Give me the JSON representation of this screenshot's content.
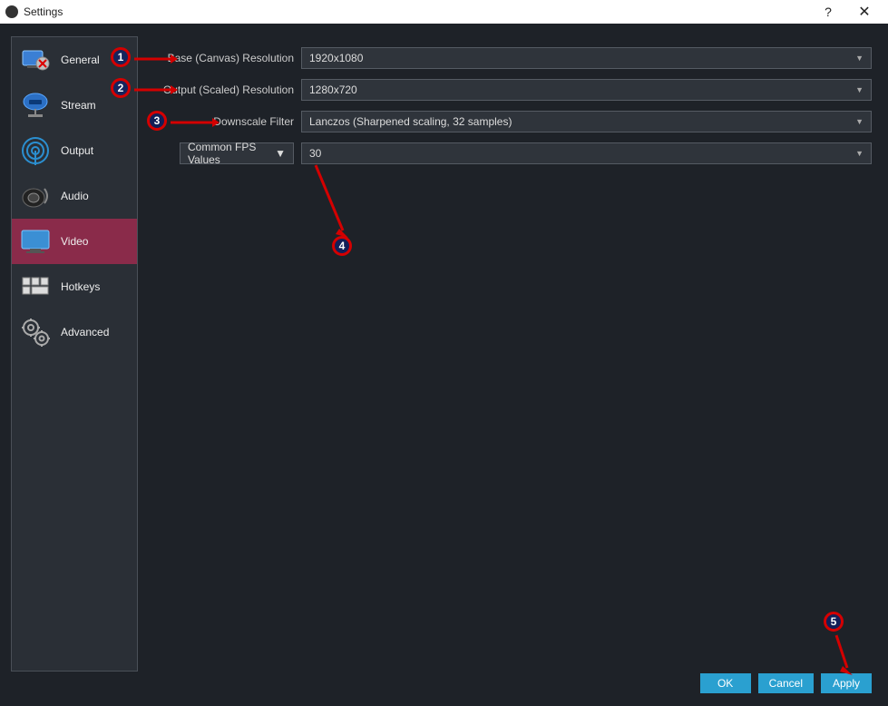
{
  "window": {
    "title": "Settings",
    "help_symbol": "?",
    "close_symbol": "✕"
  },
  "sidebar": {
    "items": [
      {
        "label": "General"
      },
      {
        "label": "Stream"
      },
      {
        "label": "Output"
      },
      {
        "label": "Audio"
      },
      {
        "label": "Video"
      },
      {
        "label": "Hotkeys"
      },
      {
        "label": "Advanced"
      }
    ]
  },
  "video": {
    "base_label": "Base (Canvas) Resolution",
    "base_value": "1920x1080",
    "output_label": "Output (Scaled) Resolution",
    "output_value": "1280x720",
    "downscale_label": "Downscale Filter",
    "downscale_value": "Lanczos (Sharpened scaling, 32 samples)",
    "fps_type_label": "Common FPS Values",
    "fps_value": "30"
  },
  "buttons": {
    "ok": "OK",
    "cancel": "Cancel",
    "apply": "Apply"
  },
  "annotations": {
    "n1": "1",
    "n2": "2",
    "n3": "3",
    "n4": "4",
    "n5": "5"
  }
}
